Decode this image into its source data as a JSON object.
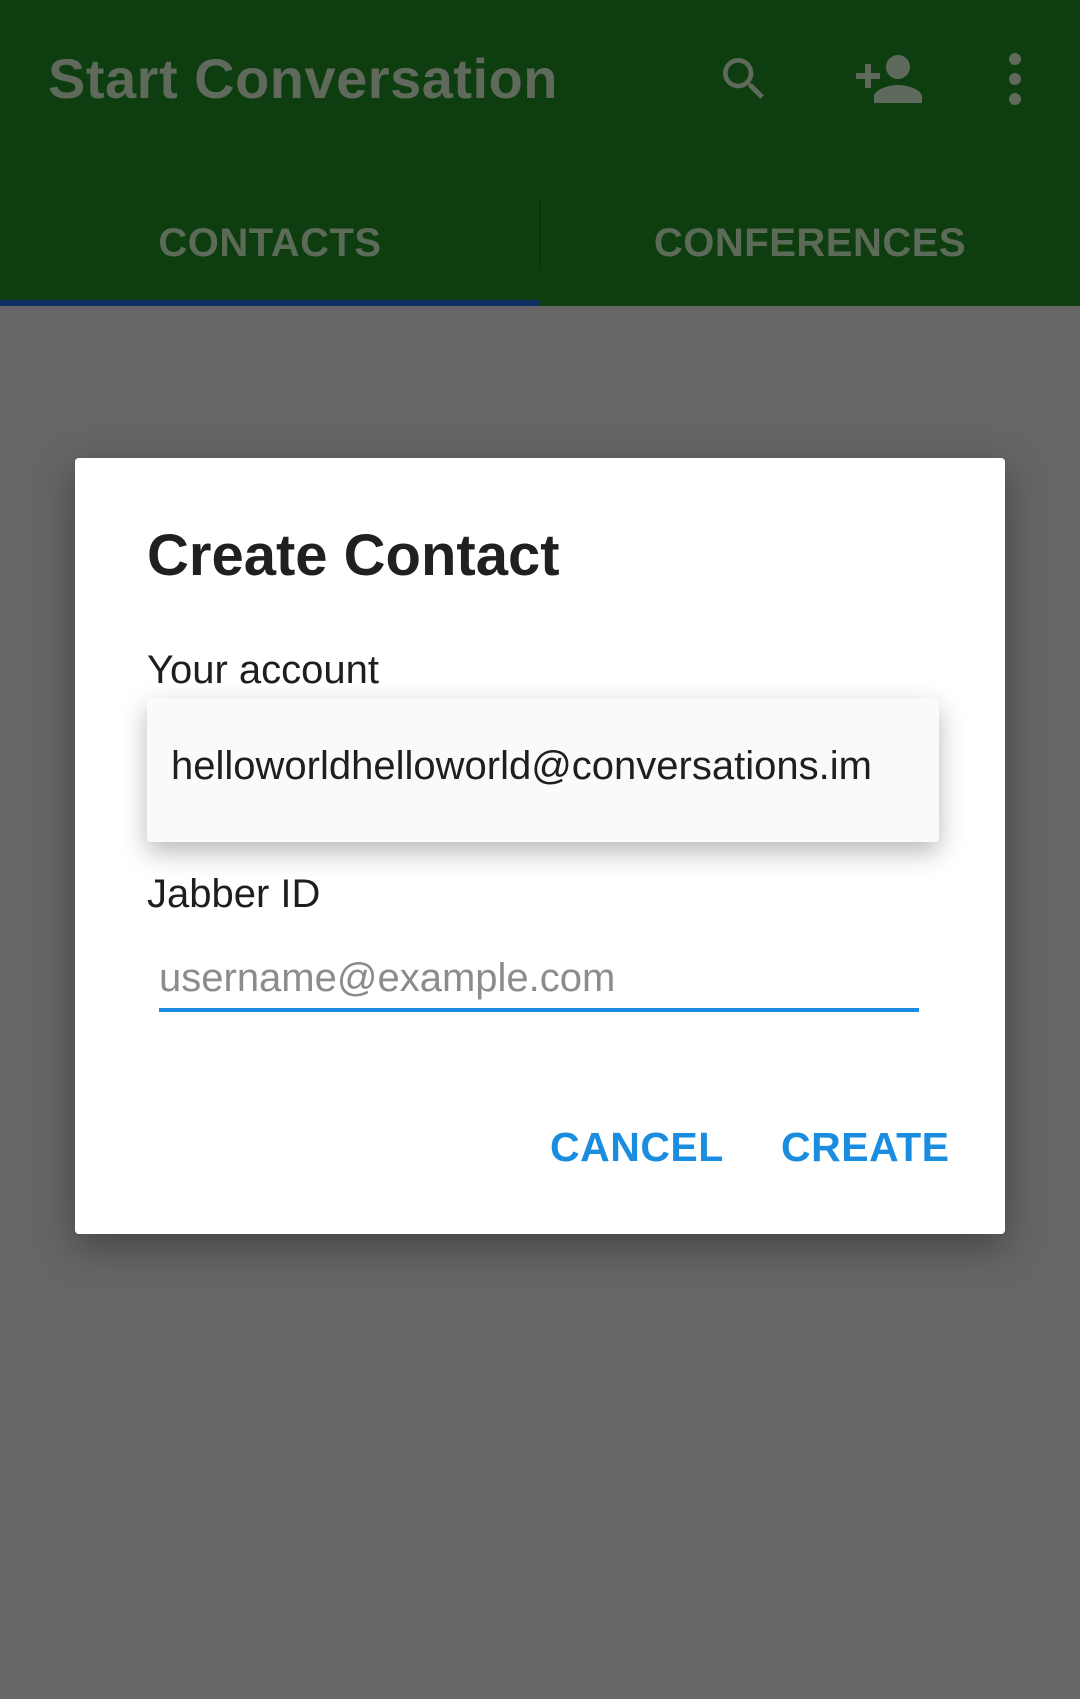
{
  "app_bar": {
    "title": "Start Conversation",
    "actions": [
      {
        "icon": "search-icon"
      },
      {
        "icon": "add-person-icon"
      },
      {
        "icon": "overflow-menu-icon"
      }
    ],
    "colors": {
      "background": "#0e3e10",
      "foreground": "#5f6a5c"
    }
  },
  "tabs": {
    "items": [
      {
        "label": "CONTACTS",
        "selected": true
      },
      {
        "label": "CONFERENCES",
        "selected": false
      }
    ],
    "indicator_color": "#0c2e63"
  },
  "dialog": {
    "title": "Create Contact",
    "account_label": "Your account",
    "account_value": "helloworldhelloworld@conversations.im",
    "jid_label": "Jabber ID",
    "jid_value": "",
    "jid_placeholder": "username@example.com",
    "cancel_label": "CANCEL",
    "create_label": "CREATE",
    "accent_color": "#1a8de0"
  },
  "scrim_color": "#666666"
}
